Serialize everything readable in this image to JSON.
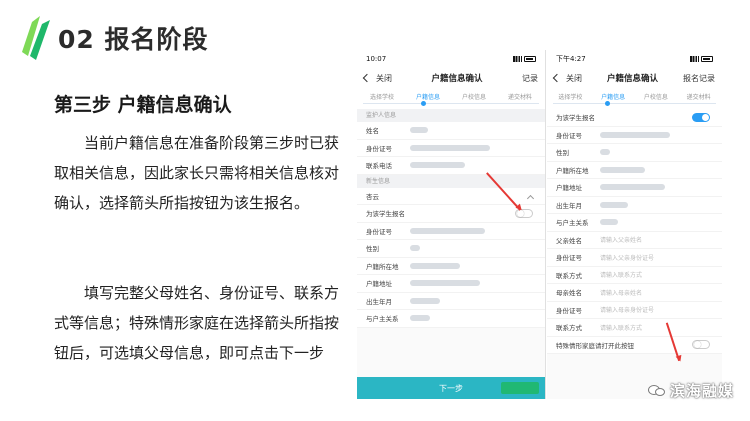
{
  "slide": {
    "title": "02 报名阶段",
    "step_heading": "第三步 户籍信息确认",
    "para1": "当前户籍信息在准备阶段第三步时已获取相关信息，因此家长只需将相关信息核对确认，选择箭头所指按钮为该生报名。",
    "para2": "填写完整父母姓名、身份证号、联系方式等信息；特殊情形家庭在选择箭头所指按钮后，可选填父母信息，即可点击下一步"
  },
  "phone_a": {
    "time": "10:07",
    "back_label": "关闭",
    "title": "户籍信息确认",
    "right_label": "记录",
    "steps": [
      "选择学校",
      "户籍信息",
      "户校信息",
      "递交材料"
    ],
    "active_step": 1,
    "guardian_section": "监护人信息",
    "guardian_rows": [
      "姓名",
      "身份证号",
      "联系电话"
    ],
    "student_section": "新生信息",
    "student_name": "杏云",
    "toggle_label": "为该学生报名",
    "toggle_on": false,
    "student_rows": [
      "身份证号",
      "性别",
      "户籍所在地",
      "户籍地址",
      "出生年月",
      "与户主关系"
    ],
    "next_button": "下一步"
  },
  "phone_b": {
    "time": "下午4:27",
    "back_label": "关闭",
    "title": "户籍信息确认",
    "right_label": "报名记录",
    "steps": [
      "选择学校",
      "户籍信息",
      "户校信息",
      "递交材料"
    ],
    "active_step": 1,
    "toggle_label": "为该学生报名",
    "toggle_on": true,
    "info_rows": [
      "身份证号",
      "性别",
      "户籍所在地",
      "户籍地址",
      "出生年月",
      "与户主关系"
    ],
    "parent_rows": [
      {
        "label": "父亲姓名",
        "placeholder": "请输入父亲姓名"
      },
      {
        "label": "身份证号",
        "placeholder": "请输入父亲身份证号"
      },
      {
        "label": "联系方式",
        "placeholder": "请输入联系方式"
      },
      {
        "label": "母亲姓名",
        "placeholder": "请输入母亲姓名"
      },
      {
        "label": "身份证号",
        "placeholder": "请输入母亲身份证号"
      },
      {
        "label": "联系方式",
        "placeholder": "请输入联系方式"
      }
    ],
    "special_label": "特殊情形家庭请打开此按钮",
    "special_on": false
  },
  "watermark": "滨海融媒",
  "colors": {
    "accent": "#2a9df4",
    "button": "#2bb6c4",
    "arrow": "#e53935",
    "logo_green": "#1fb86a"
  }
}
